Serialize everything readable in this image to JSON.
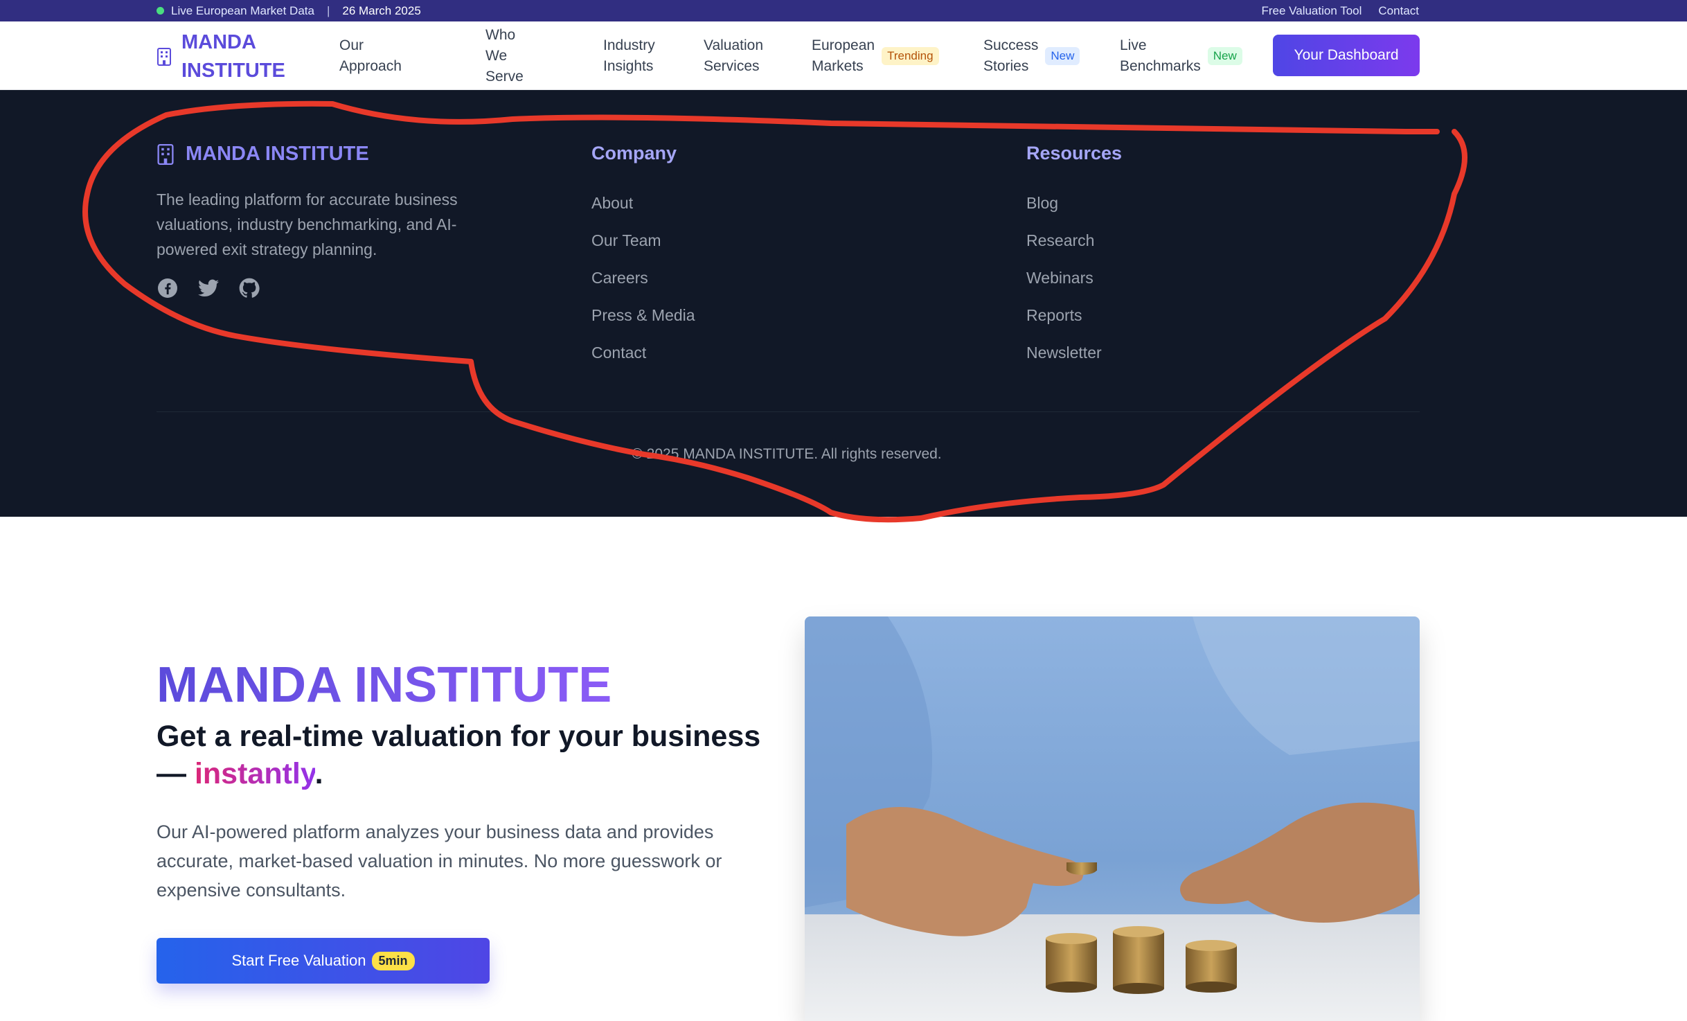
{
  "topbar": {
    "live_label": "Live European Market Data",
    "separator": "|",
    "date": "26 March 2025",
    "links": [
      "Free Valuation Tool",
      "Contact"
    ]
  },
  "nav": {
    "brand": "MANDA INSTITUTE",
    "items": [
      {
        "label": "Our\nApproach"
      },
      {
        "label": "Who\nWe\nServe"
      },
      {
        "label": "Industry\nInsights"
      },
      {
        "label": "Valuation\nServices"
      },
      {
        "label": "European\nMarkets",
        "badge": "Trending"
      },
      {
        "label": "Success\nStories",
        "badge": "New"
      },
      {
        "label": "Live\nBenchmarks",
        "badge": "New"
      }
    ],
    "dashboard_button": "Your Dashboard"
  },
  "footer": {
    "brand": "MANDA INSTITUTE",
    "description": "The leading platform for accurate business valuations, industry benchmarking, and AI-powered exit strategy planning.",
    "socials": [
      "facebook-icon",
      "twitter-icon",
      "github-icon"
    ],
    "company": {
      "title": "Company",
      "links": [
        "About",
        "Our Team",
        "Careers",
        "Press & Media",
        "Contact"
      ]
    },
    "resources": {
      "title": "Resources",
      "links": [
        "Blog",
        "Research",
        "Webinars",
        "Reports",
        "Newsletter"
      ]
    },
    "copyright": "© 2025 MANDA INSTITUTE. All rights reserved."
  },
  "hero": {
    "title": "MANDA INSTITUTE",
    "subtitle_prefix": "Get a real-time valuation for your business — ",
    "subtitle_highlight": "instantly",
    "subtitle_suffix": ".",
    "description": "Our AI-powered platform analyzes your business data and provides accurate, market-based valuation in minutes. No more guesswork or expensive consultants.",
    "cta_label": "Start Free Valuation",
    "cta_badge": "5min"
  },
  "colors": {
    "topbar": "#312e81",
    "brand": "#5b4bdb",
    "footer_bg": "#111827",
    "annotation": "#e8392a"
  }
}
